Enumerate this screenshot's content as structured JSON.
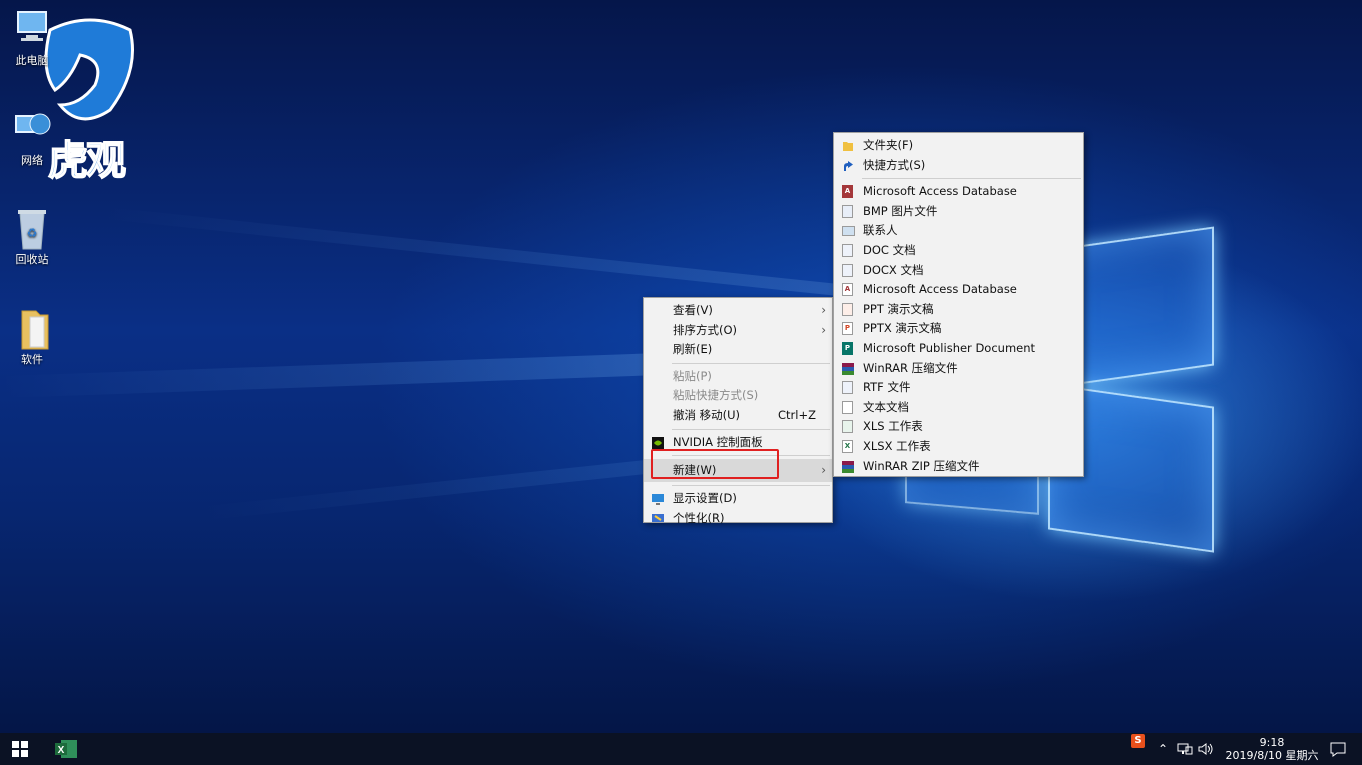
{
  "desktop": {
    "icons": [
      {
        "label": "此电脑",
        "icon": "computer-icon"
      },
      {
        "label": "网络",
        "icon": "network-icon"
      },
      {
        "label": "回收站",
        "icon": "recycle-bin-icon"
      },
      {
        "label": "软件",
        "icon": "folder-icon"
      }
    ],
    "watermark": "虎观"
  },
  "context_menu": {
    "items": [
      {
        "label": "查看(V)",
        "submenu": true
      },
      {
        "label": "排序方式(O)",
        "submenu": true
      },
      {
        "label": "刷新(E)"
      },
      {
        "label": "粘贴(P)",
        "disabled": true
      },
      {
        "label": "粘贴快捷方式(S)",
        "disabled": true
      },
      {
        "label": "撤消 移动(U)",
        "shortcut": "Ctrl+Z"
      },
      {
        "label": "NVIDIA 控制面板",
        "icon": "nvidia-icon"
      },
      {
        "label": "新建(W)",
        "submenu": true,
        "active": true
      },
      {
        "label": "显示设置(D)",
        "icon": "display-settings-icon"
      },
      {
        "label": "个性化(R)",
        "icon": "personalize-icon"
      }
    ]
  },
  "new_submenu": {
    "items": [
      {
        "label": "文件夹(F)",
        "icon": "folder-icon"
      },
      {
        "label": "快捷方式(S)",
        "icon": "shortcut-icon"
      },
      {
        "label": "Microsoft Access Database",
        "icon": "access-icon"
      },
      {
        "label": "BMP 图片文件",
        "icon": "bmp-icon"
      },
      {
        "label": "联系人",
        "icon": "contact-icon"
      },
      {
        "label": "DOC 文档",
        "icon": "doc-icon"
      },
      {
        "label": "DOCX 文档",
        "icon": "docx-icon"
      },
      {
        "label": "Microsoft Access Database",
        "icon": "access-icon"
      },
      {
        "label": "PPT 演示文稿",
        "icon": "ppt-icon"
      },
      {
        "label": "PPTX 演示文稿",
        "icon": "pptx-icon"
      },
      {
        "label": "Microsoft Publisher Document",
        "icon": "publisher-icon"
      },
      {
        "label": "WinRAR 压缩文件",
        "icon": "winrar-icon"
      },
      {
        "label": "RTF 文件",
        "icon": "rtf-icon"
      },
      {
        "label": "文本文档",
        "icon": "text-icon"
      },
      {
        "label": "XLS 工作表",
        "icon": "xls-icon"
      },
      {
        "label": "XLSX 工作表",
        "icon": "xlsx-icon"
      },
      {
        "label": "WinRAR ZIP 压缩文件",
        "icon": "winrar-zip-icon"
      }
    ]
  },
  "taskbar": {
    "clock_time": "9:18",
    "clock_date": "2019/8/10 星期六",
    "tray_ime": "S"
  },
  "colors": {
    "accent_red": "#e02020",
    "access": "#a4373a",
    "word": "#2b579a",
    "powerpoint": "#d24726",
    "publisher": "#077568",
    "excel": "#217346"
  }
}
